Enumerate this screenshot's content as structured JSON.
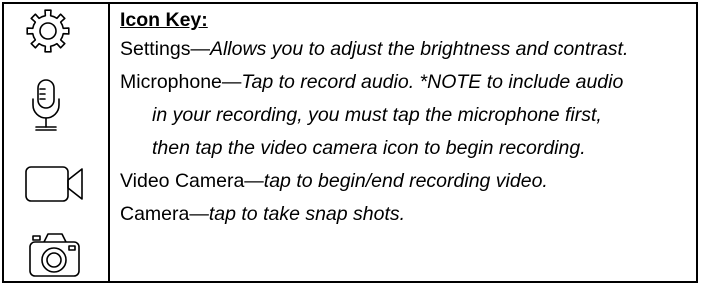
{
  "icon_key": {
    "heading": "Icon Key:",
    "settings": {
      "name": "Settings",
      "separator": "—",
      "description": "Allows you to adjust the brightness and contrast."
    },
    "microphone": {
      "name": "Microphone",
      "separator": "—",
      "description_line1": "Tap to record audio. *NOTE to include audio",
      "description_line2": "in your recording, you must tap the microphone first,",
      "description_line3": "then tap the video camera icon to begin recording."
    },
    "video_camera": {
      "name": "Video Camera",
      "separator": "—",
      "description": "tap to begin/end recording video."
    },
    "camera": {
      "name": "Camera",
      "separator": "—",
      "description": "tap to take snap shots."
    }
  },
  "icons": [
    "gear-icon",
    "microphone-icon",
    "video-camera-icon",
    "camera-icon"
  ]
}
